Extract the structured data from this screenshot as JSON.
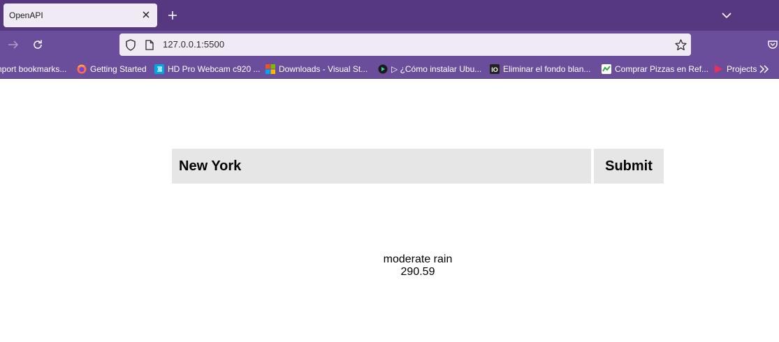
{
  "browser": {
    "tab": {
      "title": "OpenAPI"
    },
    "url": "127.0.0.1:5500",
    "bookmarks": [
      {
        "label": "nport bookmarks...",
        "icon": "import-bookmarks-icon"
      },
      {
        "label": "Getting Started",
        "icon": "firefox-icon"
      },
      {
        "label": "HD Pro Webcam c920 ...",
        "icon": "webcam-site-icon"
      },
      {
        "label": "Downloads - Visual St...",
        "icon": "microsoft-icon"
      },
      {
        "label": "▷ ¿Cómo instalar Ubu...",
        "icon": "video-site-icon"
      },
      {
        "label": "Eliminar el fondo blan...",
        "icon": "io-icon"
      },
      {
        "label": "Comprar Pizzas en Ref...",
        "icon": "pizza-site-icon"
      },
      {
        "label": "Projects",
        "icon": "projects-icon"
      }
    ]
  },
  "form": {
    "city_value": "New York",
    "submit_label": "Submit"
  },
  "result": {
    "description": "moderate rain",
    "temperature": "290.59"
  },
  "colors": {
    "tabstrip": "#55387f",
    "toolbar": "#6b4e9b",
    "urlbar": "#f0eaf5",
    "input_bg": "#e6e6e6"
  }
}
